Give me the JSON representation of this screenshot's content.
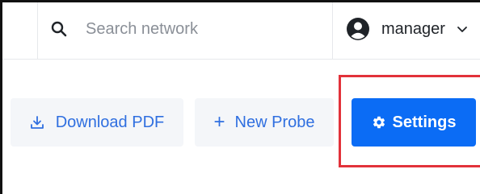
{
  "topbar": {
    "search": {
      "placeholder": "Search network",
      "icon": "search-icon"
    },
    "user": {
      "name": "manager",
      "avatar_icon": "user-circle-icon",
      "chevron_icon": "chevron-down-icon"
    }
  },
  "toolbar": {
    "download_label": "Download PDF",
    "download_icon": "download-icon",
    "new_probe_label": "New Probe",
    "new_probe_icon": "+",
    "settings_label": "Settings",
    "settings_icon": "gear-icon"
  },
  "colors": {
    "primary": "#0b6cf5",
    "link_blue": "#2f6fe0",
    "secondary_bg": "#f4f6f9",
    "highlight": "#e2323a"
  }
}
